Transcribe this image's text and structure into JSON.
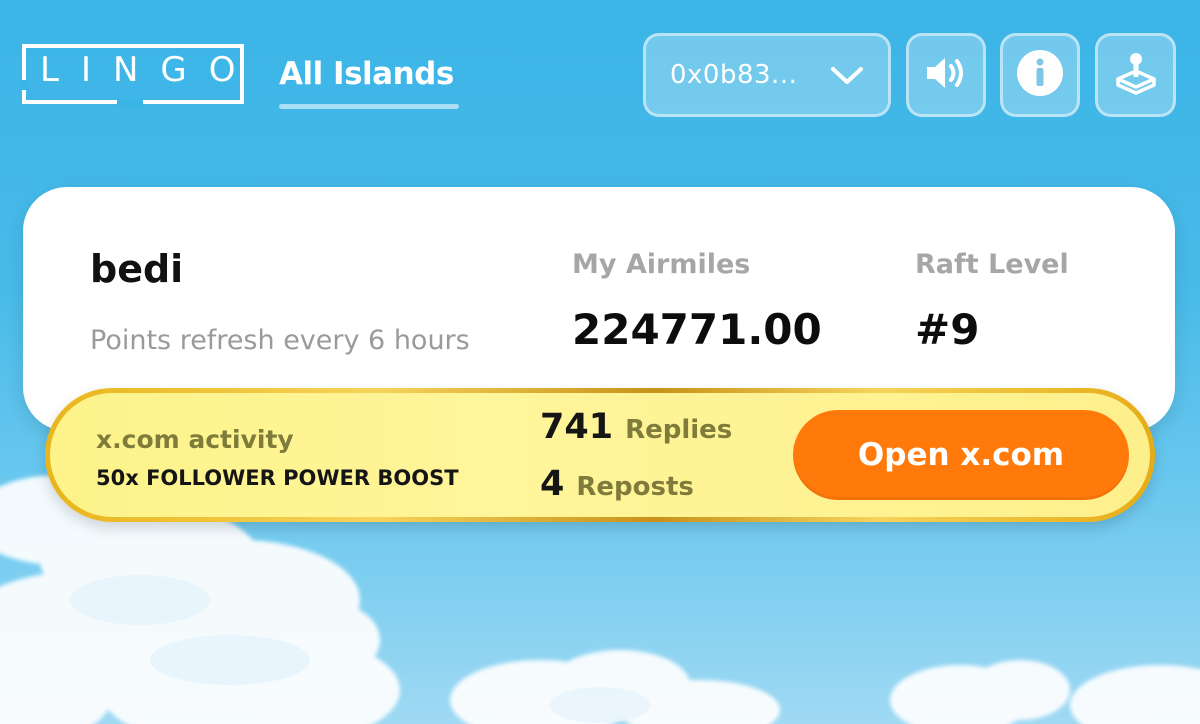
{
  "header": {
    "logo_text": "LINGO",
    "nav_link_label": "All Islands",
    "wallet_label": "0x0b83...",
    "icons": {
      "wallet_dropdown": "chevron-down-icon",
      "sound": "speaker-icon",
      "info": "info-icon",
      "game": "joystick-icon"
    }
  },
  "profile": {
    "username": "bedi",
    "refresh_note": "Points refresh every 6 hours",
    "airmiles_label": "My Airmiles",
    "airmiles_value": "224771.00",
    "raft_label": "Raft Level",
    "raft_value": "#9"
  },
  "activity": {
    "title": "x.com activity",
    "boost": "50x FOLLOWER POWER BOOST",
    "replies_count": "741",
    "replies_label": "Replies",
    "reposts_count": "4",
    "reposts_label": "Reposts",
    "open_button_label": "Open x.com"
  },
  "colors": {
    "sky": "#3bb4e6",
    "button_orange": "#ff7a0a",
    "banner_yellow": "#fff59a",
    "banner_gold": "#e8b51c"
  }
}
